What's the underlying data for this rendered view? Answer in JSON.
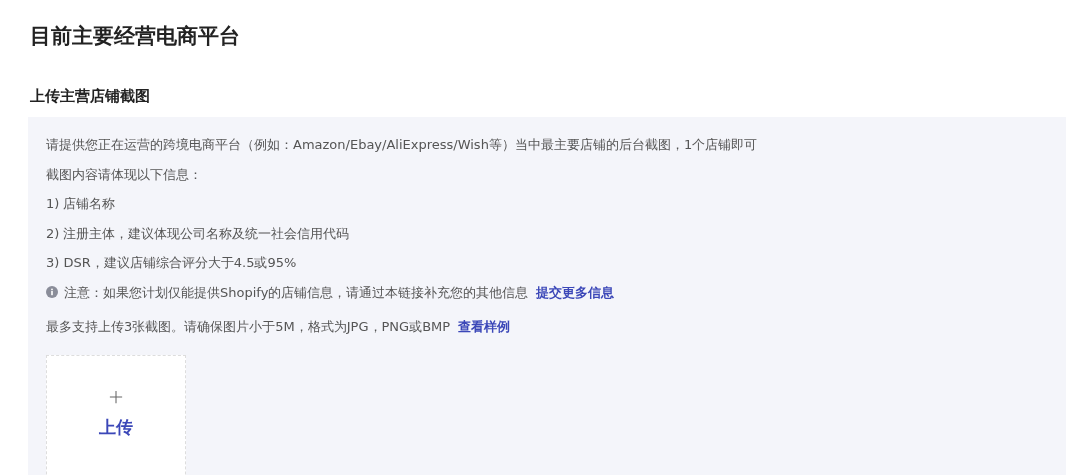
{
  "section_title": "目前主要经营电商平台",
  "upload_section": {
    "title": "上传主营店铺截图",
    "lines": [
      "请提供您正在运营的跨境电商平台（例如：Amazon/Ebay/AliExpress/Wish等）当中最主要店铺的后台截图，1个店铺即可",
      "截图内容请体现以下信息：",
      "1) 店铺名称",
      "2) 注册主体，建议体现公司名称及统一社会信用代码",
      "3) DSR，建议店铺综合评分大于4.5或95%"
    ],
    "notice": {
      "text": "注意：如果您计划仅能提供Shopify的店铺信息，请通过本链接补充您的其他信息",
      "link": "提交更多信息"
    },
    "limits": {
      "text": "最多支持上传3张截图。请确保图片小于5M，格式为JPG，PNG或BMP",
      "link": "查看样例"
    },
    "upload_button": "上传"
  }
}
